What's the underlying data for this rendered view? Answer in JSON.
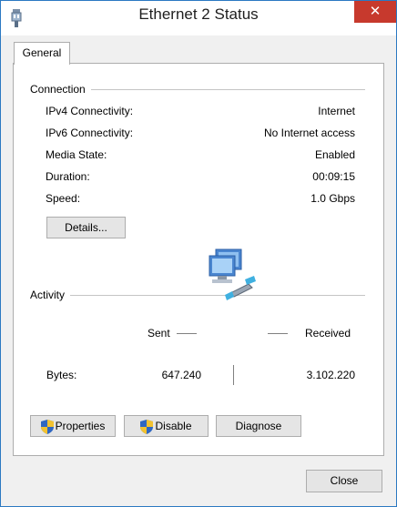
{
  "window": {
    "title": "Ethernet 2 Status",
    "close_glyph": "✕"
  },
  "tabs": [
    {
      "label": "General"
    }
  ],
  "connection": {
    "title": "Connection",
    "rows": [
      {
        "label": "IPv4 Connectivity:",
        "value": "Internet"
      },
      {
        "label": "IPv6 Connectivity:",
        "value": "No Internet access"
      },
      {
        "label": "Media State:",
        "value": "Enabled"
      },
      {
        "label": "Duration:",
        "value": "00:09:15"
      },
      {
        "label": "Speed:",
        "value": "1.0 Gbps"
      }
    ],
    "details_button": "Details..."
  },
  "activity": {
    "title": "Activity",
    "sent_label": "Sent",
    "received_label": "Received",
    "bytes_label": "Bytes:",
    "bytes_sent": "647.240",
    "bytes_received": "3.102.220"
  },
  "actions": {
    "properties": "Properties",
    "disable": "Disable",
    "diagnose": "Diagnose"
  },
  "footer": {
    "close": "Close"
  },
  "icons": {
    "title_icon": "ethernet-plug-icon",
    "network_icon": "network-computers-icon",
    "shield_icon": "uac-shield-icon"
  }
}
